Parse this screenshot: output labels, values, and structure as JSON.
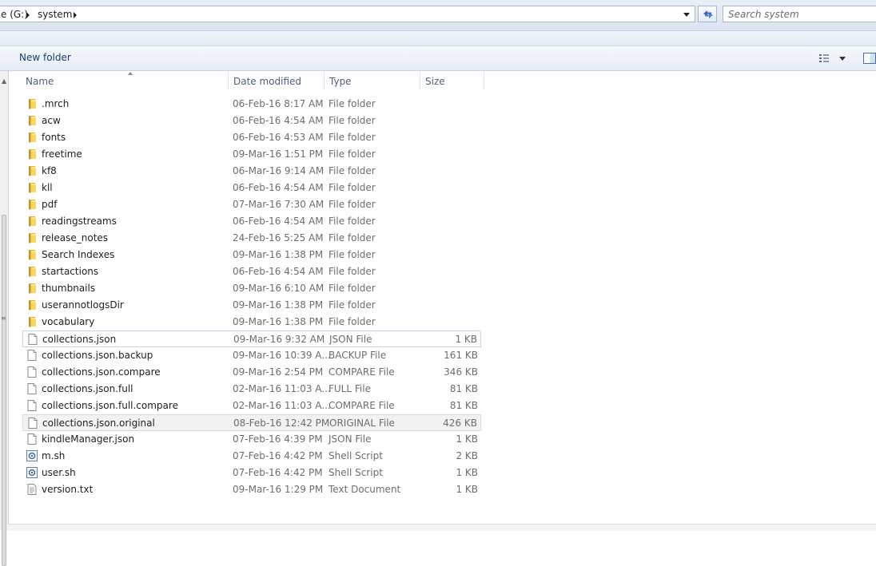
{
  "address": {
    "crumbs": [
      "e (G:)",
      "system"
    ],
    "search_placeholder": "Search system"
  },
  "toolbar": {
    "new_folder_label": "New folder"
  },
  "columns": {
    "name": "Name",
    "date": "Date modified",
    "type": "Type",
    "size": "Size"
  },
  "files": [
    {
      "name": ".mrch",
      "date": "06-Feb-16 8:17 AM",
      "type": "File folder",
      "size": "",
      "icon": "folder-icon",
      "state": ""
    },
    {
      "name": "acw",
      "date": "06-Feb-16 4:54 AM",
      "type": "File folder",
      "size": "",
      "icon": "folder-icon",
      "state": ""
    },
    {
      "name": "fonts",
      "date": "06-Feb-16 4:53 AM",
      "type": "File folder",
      "size": "",
      "icon": "folder-icon",
      "state": ""
    },
    {
      "name": "freetime",
      "date": "09-Mar-16 1:51 PM",
      "type": "File folder",
      "size": "",
      "icon": "folder-icon",
      "state": ""
    },
    {
      "name": "kf8",
      "date": "06-Mar-16 9:14 AM",
      "type": "File folder",
      "size": "",
      "icon": "folder-icon",
      "state": ""
    },
    {
      "name": "kll",
      "date": "06-Feb-16 4:54 AM",
      "type": "File folder",
      "size": "",
      "icon": "folder-icon",
      "state": ""
    },
    {
      "name": "pdf",
      "date": "07-Mar-16 7:30 AM",
      "type": "File folder",
      "size": "",
      "icon": "folder-icon",
      "state": ""
    },
    {
      "name": "readingstreams",
      "date": "06-Feb-16 4:54 AM",
      "type": "File folder",
      "size": "",
      "icon": "folder-icon",
      "state": ""
    },
    {
      "name": "release_notes",
      "date": "24-Feb-16 5:25 AM",
      "type": "File folder",
      "size": "",
      "icon": "folder-icon",
      "state": ""
    },
    {
      "name": "Search Indexes",
      "date": "09-Mar-16 1:38 PM",
      "type": "File folder",
      "size": "",
      "icon": "folder-icon",
      "state": ""
    },
    {
      "name": "startactions",
      "date": "06-Feb-16 4:54 AM",
      "type": "File folder",
      "size": "",
      "icon": "folder-icon",
      "state": ""
    },
    {
      "name": "thumbnails",
      "date": "09-Mar-16 6:10 AM",
      "type": "File folder",
      "size": "",
      "icon": "folder-icon",
      "state": ""
    },
    {
      "name": "userannotlogsDir",
      "date": "09-Mar-16 1:38 PM",
      "type": "File folder",
      "size": "",
      "icon": "folder-icon",
      "state": ""
    },
    {
      "name": "vocabulary",
      "date": "09-Mar-16 1:38 PM",
      "type": "File folder",
      "size": "",
      "icon": "folder-icon",
      "state": ""
    },
    {
      "name": "collections.json",
      "date": "09-Mar-16 9:32 AM",
      "type": "JSON File",
      "size": "1 KB",
      "icon": "file-icon",
      "state": "sel"
    },
    {
      "name": "collections.json.backup",
      "date": "09-Mar-16 10:39 A...",
      "type": "BACKUP File",
      "size": "161 KB",
      "icon": "file-icon",
      "state": ""
    },
    {
      "name": "collections.json.compare",
      "date": "09-Mar-16 2:54 PM",
      "type": "COMPARE File",
      "size": "346 KB",
      "icon": "file-icon",
      "state": ""
    },
    {
      "name": "collections.json.full",
      "date": "02-Mar-16 11:03 A...",
      "type": "FULL File",
      "size": "81 KB",
      "icon": "file-icon",
      "state": ""
    },
    {
      "name": "collections.json.full.compare",
      "date": "02-Mar-16 11:03 A...",
      "type": "COMPARE File",
      "size": "81 KB",
      "icon": "file-icon",
      "state": ""
    },
    {
      "name": "collections.json.original",
      "date": "08-Feb-16 12:42 PM",
      "type": "ORIGINAL File",
      "size": "426 KB",
      "icon": "file-icon",
      "state": "hov"
    },
    {
      "name": "kindleManager.json",
      "date": "07-Feb-16 4:39 PM",
      "type": "JSON File",
      "size": "1 KB",
      "icon": "file-icon",
      "state": ""
    },
    {
      "name": "m.sh",
      "date": "07-Feb-16 4:42 PM",
      "type": "Shell Script",
      "size": "2 KB",
      "icon": "script-icon",
      "state": ""
    },
    {
      "name": "user.sh",
      "date": "07-Feb-16 4:42 PM",
      "type": "Shell Script",
      "size": "1 KB",
      "icon": "script-icon",
      "state": ""
    },
    {
      "name": "version.txt",
      "date": "09-Mar-16 1:29 PM",
      "type": "Text Document",
      "size": "1 KB",
      "icon": "text-file-icon",
      "state": ""
    }
  ]
}
